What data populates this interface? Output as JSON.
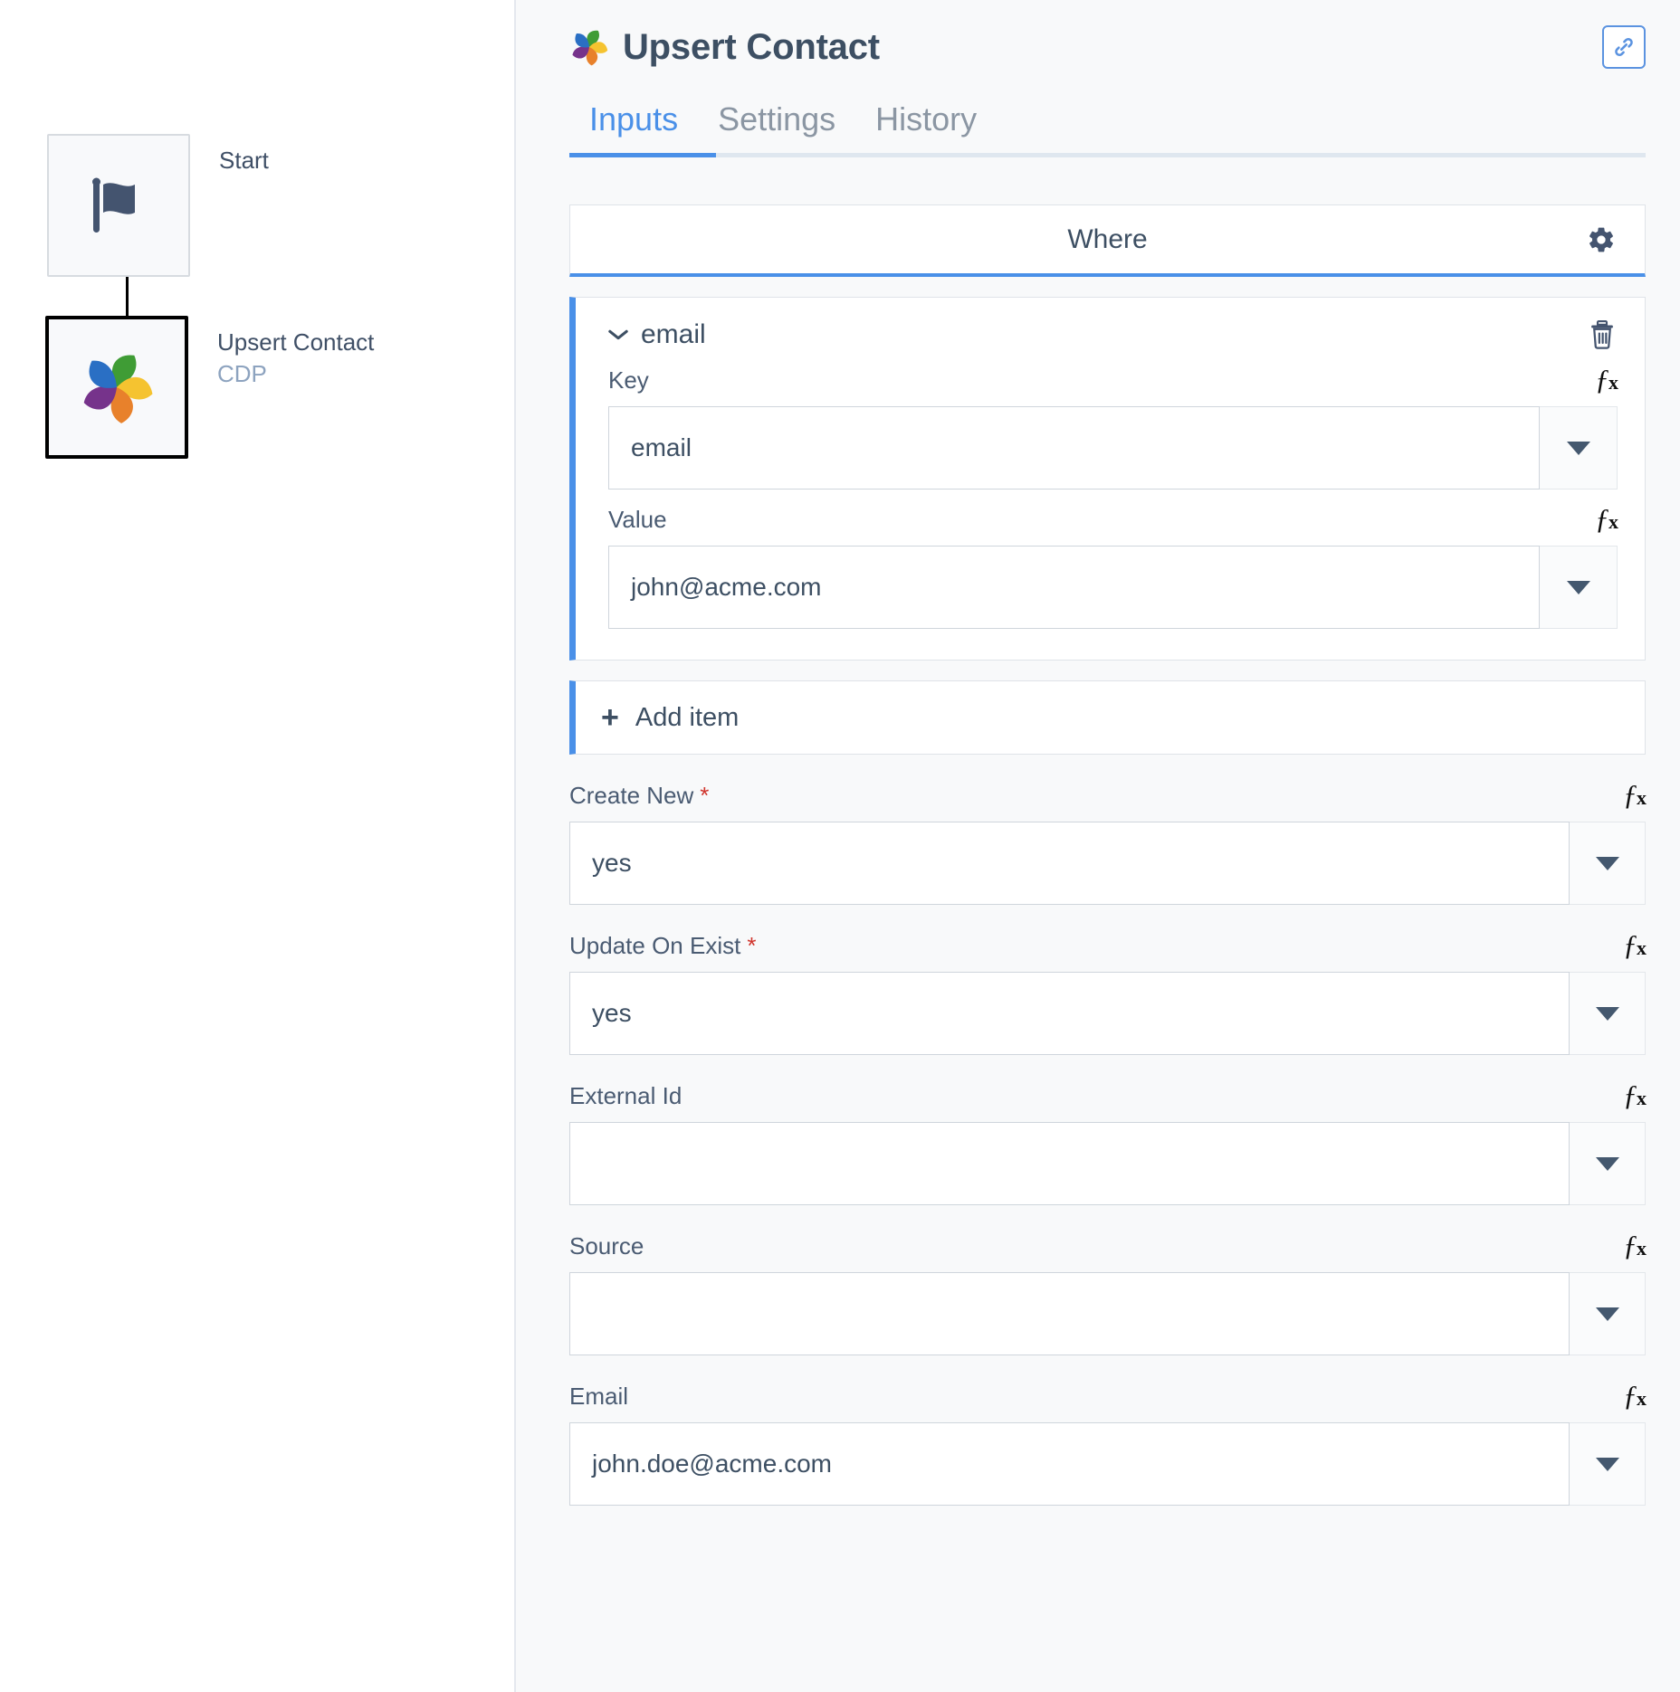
{
  "canvas": {
    "nodes": [
      {
        "title": "Start",
        "subtitle": "",
        "icon": "flag-icon",
        "selected": false
      },
      {
        "title": "Upsert Contact",
        "subtitle": "CDP",
        "icon": "cdp-logo-icon",
        "selected": true
      }
    ]
  },
  "header": {
    "title": "Upsert Contact",
    "logo_icon": "cdp-logo-icon",
    "action_icon": "link-chain-icon"
  },
  "tabs": [
    {
      "label": "Inputs",
      "active": true
    },
    {
      "label": "Settings",
      "active": false
    },
    {
      "label": "History",
      "active": false
    }
  ],
  "form": {
    "where": {
      "label": "Where",
      "gear_icon": "gear-icon"
    },
    "item": {
      "name": "email",
      "chevron_icon": "chevron-down-icon",
      "delete_icon": "trash-icon",
      "fields": [
        {
          "label": "Key",
          "value": "email",
          "required": false,
          "fx_icon": "fx-icon",
          "caret_icon": "chevron-down-icon"
        },
        {
          "label": "Value",
          "value": "john@acme.com",
          "required": false,
          "fx_icon": "fx-icon",
          "caret_icon": "chevron-down-icon"
        }
      ]
    },
    "add_item": {
      "label": "Add item",
      "plus_icon": "plus-icon"
    },
    "fields": [
      {
        "label": "Create New",
        "required": true,
        "value": "yes",
        "fx_icon": "fx-icon",
        "caret_icon": "chevron-down-icon"
      },
      {
        "label": "Update On Exist",
        "required": true,
        "value": "yes",
        "fx_icon": "fx-icon",
        "caret_icon": "chevron-down-icon"
      },
      {
        "label": "External Id",
        "required": false,
        "value": "",
        "fx_icon": "fx-icon",
        "caret_icon": "chevron-down-icon"
      },
      {
        "label": "Source",
        "required": false,
        "value": "",
        "fx_icon": "fx-icon",
        "caret_icon": "chevron-down-icon"
      },
      {
        "label": "Email",
        "required": false,
        "value": "john.doe@acme.com",
        "fx_icon": "fx-icon",
        "caret_icon": "chevron-down-icon"
      }
    ]
  },
  "colors": {
    "accent_blue": "#4a90e8",
    "text_dark": "#3d4f63",
    "text_muted": "#8b96a3",
    "required_red": "#d0342c",
    "panel_bg": "#f8f9fa"
  }
}
